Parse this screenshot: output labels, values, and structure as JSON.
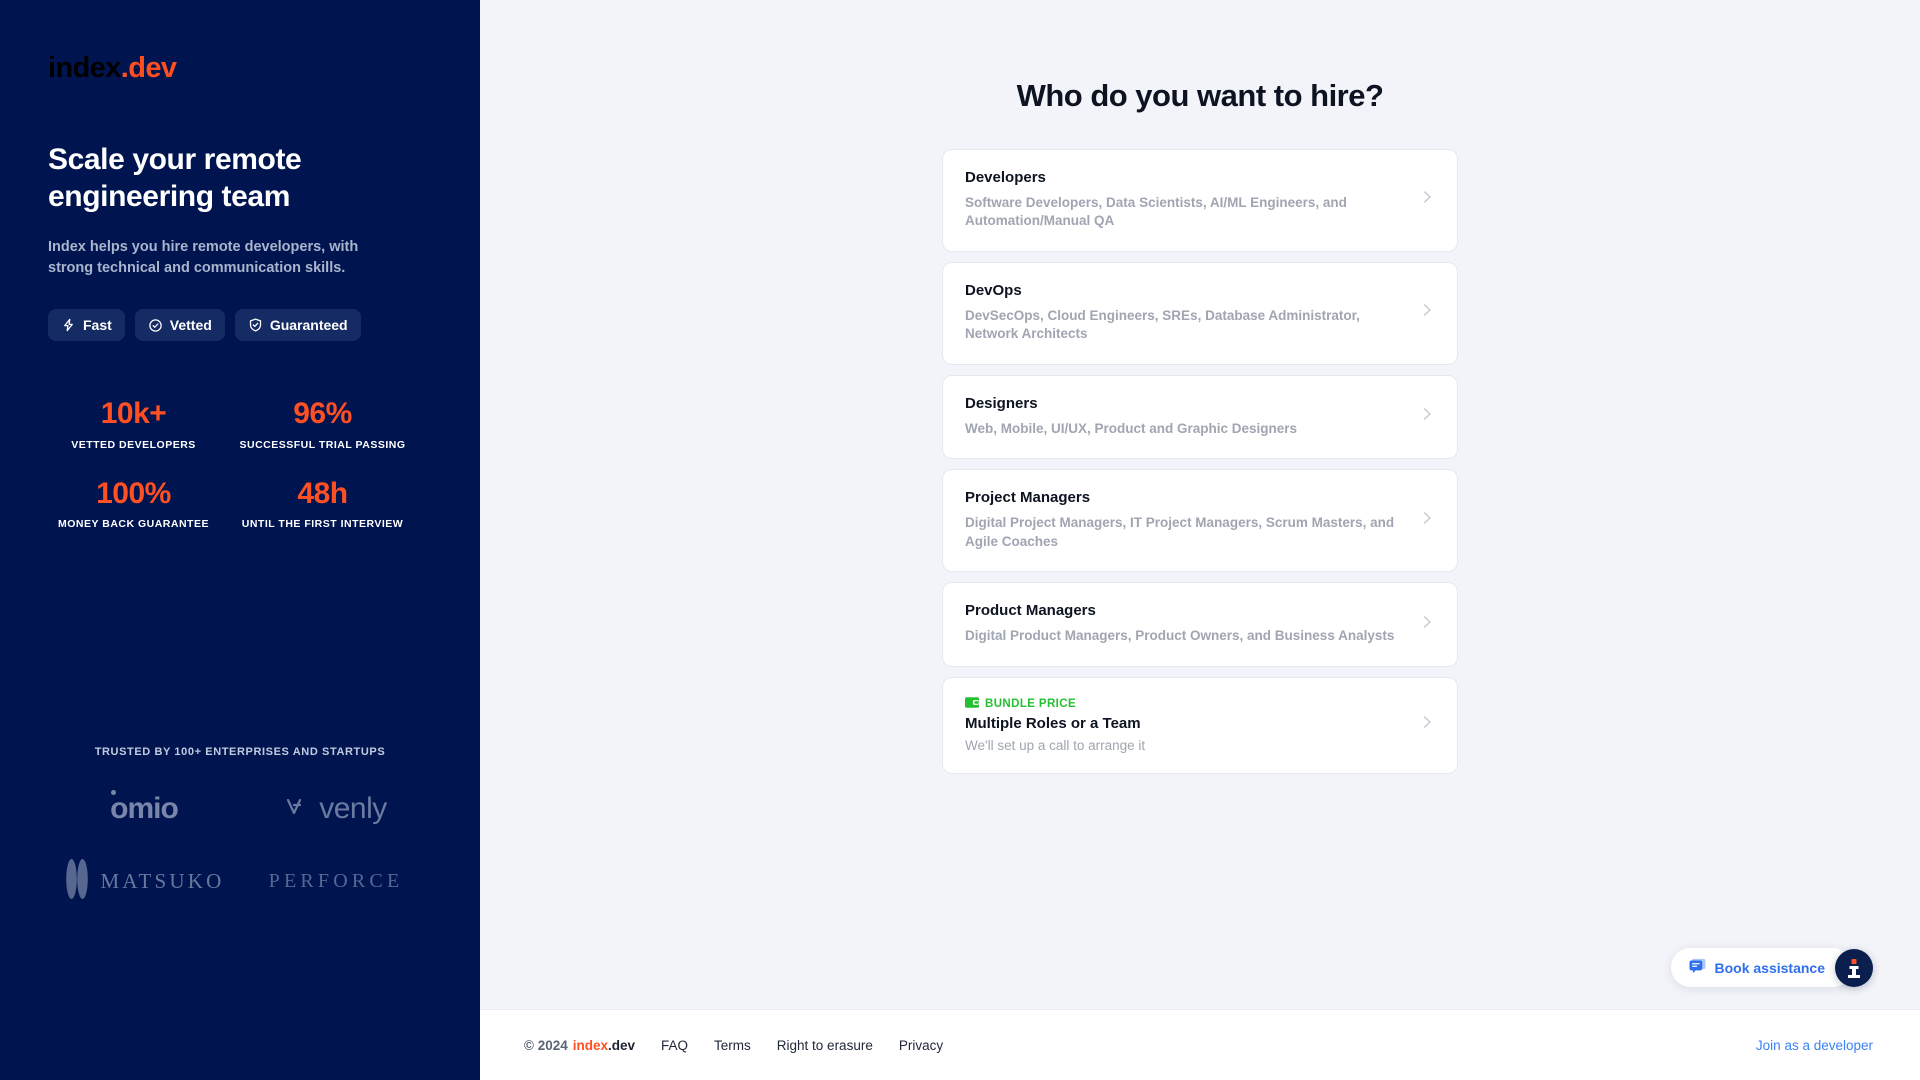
{
  "brand": {
    "logo_index": "index",
    "logo_dot": ".",
    "logo_dev": "dev",
    "accent_orange": "#FF5023",
    "navy": "#001450",
    "page_bg": "#F2F4F9"
  },
  "left": {
    "hero_title": "Scale your remote engineering team",
    "hero_subtitle": "Index helps you hire remote developers, with strong technical and communication skills.",
    "badges": [
      {
        "label": "Fast",
        "icon": "lightning-icon"
      },
      {
        "label": "Vetted",
        "icon": "check-seal-icon"
      },
      {
        "label": "Guaranteed",
        "icon": "shield-check-icon"
      }
    ],
    "stats": [
      {
        "value": "10k+",
        "label": "VETTED DEVELOPERS"
      },
      {
        "value": "96%",
        "label": "SUCCESSFUL TRIAL PASSING"
      },
      {
        "value": "100%",
        "label": "MONEY BACK GUARANTEE"
      },
      {
        "value": "48h",
        "label": "UNTIL THE FIRST INTERVIEW"
      }
    ],
    "trusted_title": "TRUSTED BY 100+ ENTERPRISES AND STARTUPS",
    "client_logos": [
      {
        "name": "omio",
        "text": "omio"
      },
      {
        "name": "venly",
        "text": "venly"
      },
      {
        "name": "matsuko",
        "text": "MATSUKO"
      },
      {
        "name": "perforce",
        "text": "PERFORCE"
      }
    ]
  },
  "main": {
    "title": "Who do you want to hire?",
    "cards": [
      {
        "title": "Developers",
        "desc": "Software Developers, Data Scientists, AI/ML Engineers, and Automation/Manual QA"
      },
      {
        "title": "DevOps",
        "desc": "DevSecOps, Cloud Engineers, SREs, Database Administrator, Network Architects"
      },
      {
        "title": "Designers",
        "desc": "Web, Mobile, UI/UX, Product and Graphic Designers"
      },
      {
        "title": "Project Managers",
        "desc": "Digital Project Managers, IT Project Managers, Scrum Masters, and Agile Coaches"
      },
      {
        "title": "Product Managers",
        "desc": "Digital Product Managers, Product Owners, and Business Analysts"
      }
    ],
    "bundle_card": {
      "tag": "BUNDLE PRICE",
      "tag_color": "#24C032",
      "tag_icon": "wallet-icon",
      "title": "Multiple Roles or a Team",
      "desc": "We'll set up a call to arrange it"
    }
  },
  "widgets": {
    "book_assistance_label": "Book assistance",
    "book_assistance_icon": "chat-bubble-icon",
    "info_badge_icon": "info-icon"
  },
  "footer": {
    "copyright_year": "© 2024",
    "copyright_index": "index",
    "copyright_dev": ".dev",
    "links": [
      {
        "label": "FAQ"
      },
      {
        "label": "Terms"
      },
      {
        "label": "Right to erasure"
      },
      {
        "label": "Privacy"
      }
    ],
    "join_label": "Join as a developer"
  }
}
